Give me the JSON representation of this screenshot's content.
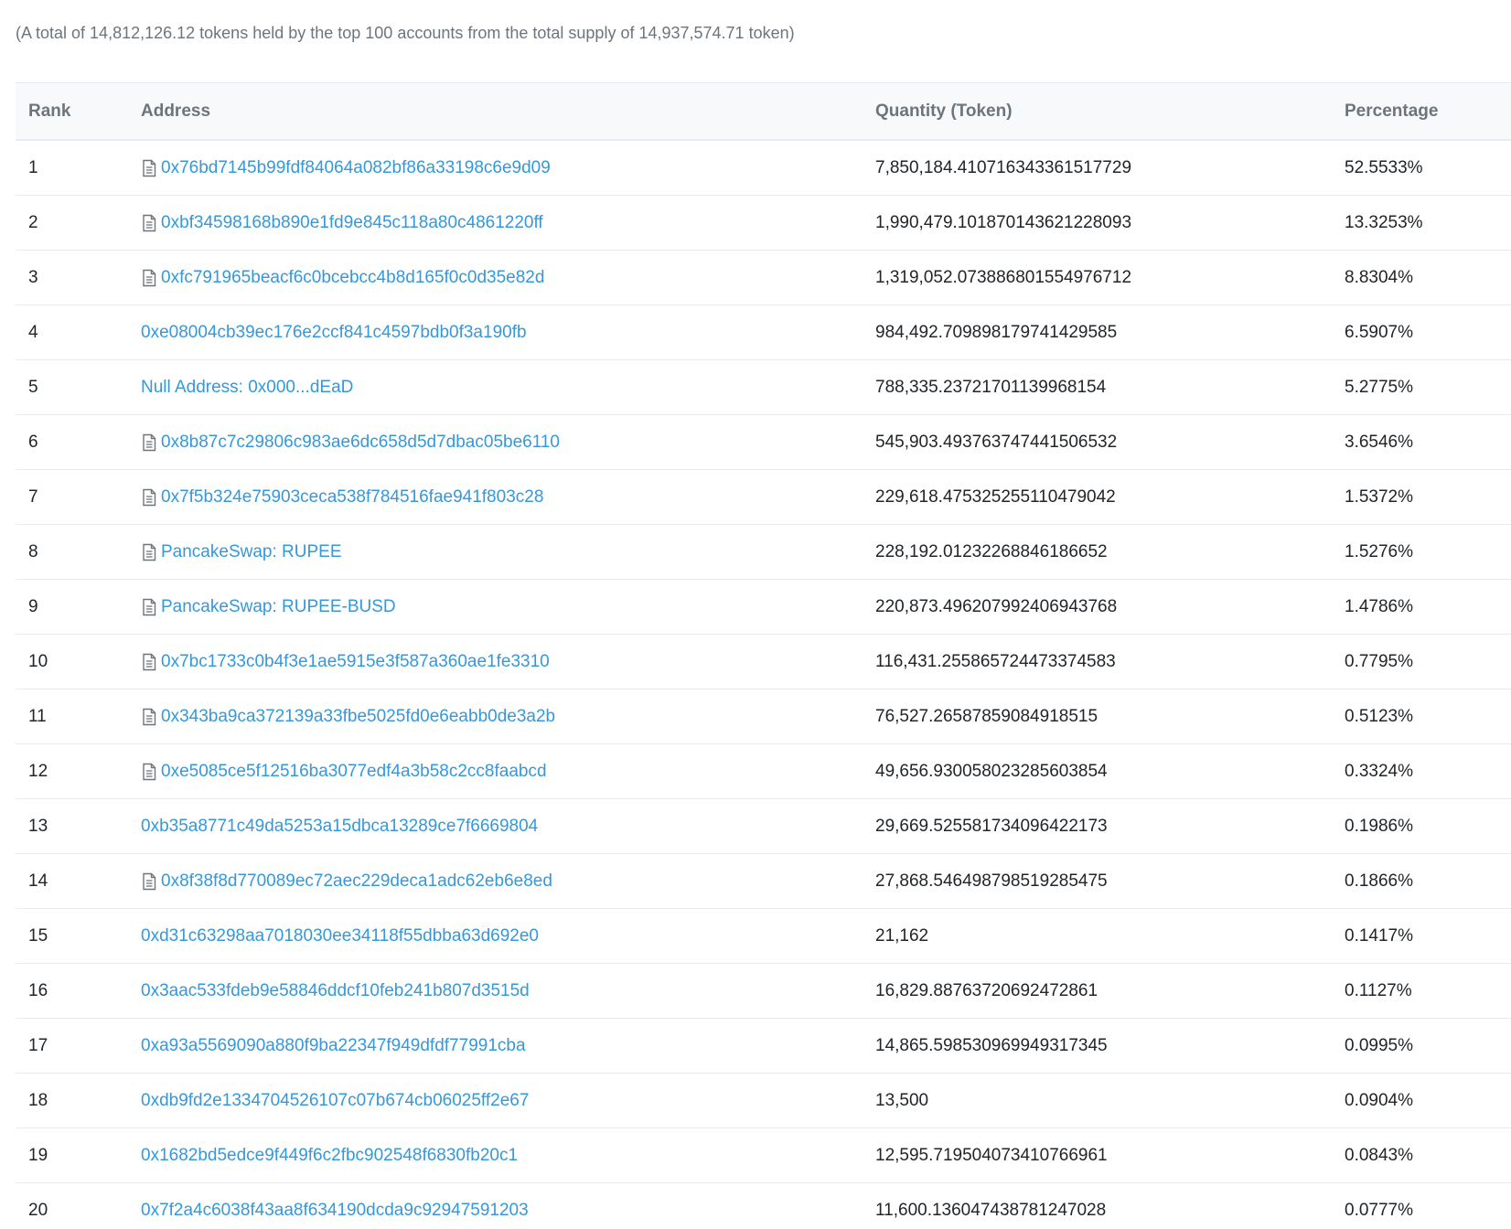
{
  "summary": "(A total of 14,812,126.12 tokens held by the top 100 accounts from the total supply of 14,937,574.71 token)",
  "table": {
    "headers": {
      "rank": "Rank",
      "address": "Address",
      "quantity": "Quantity (Token)",
      "percentage": "Percentage"
    },
    "rows": [
      {
        "rank": "1",
        "address": "0x76bd7145b99fdf84064a082bf86a33198c6e9d09",
        "contract": true,
        "quantity": "7,850,184.410716343361517729",
        "percentage": "52.5533%"
      },
      {
        "rank": "2",
        "address": "0xbf34598168b890e1fd9e845c118a80c4861220ff",
        "contract": true,
        "quantity": "1,990,479.101870143621228093",
        "percentage": "13.3253%"
      },
      {
        "rank": "3",
        "address": "0xfc791965beacf6c0bcebcc4b8d165f0c0d35e82d",
        "contract": true,
        "quantity": "1,319,052.073886801554976712",
        "percentage": "8.8304%"
      },
      {
        "rank": "4",
        "address": "0xe08004cb39ec176e2ccf841c4597bdb0f3a190fb",
        "contract": false,
        "quantity": "984,492.709898179741429585",
        "percentage": "6.5907%"
      },
      {
        "rank": "5",
        "address": "Null Address: 0x000...dEaD",
        "contract": false,
        "quantity": "788,335.23721701139968154",
        "percentage": "5.2775%"
      },
      {
        "rank": "6",
        "address": "0x8b87c7c29806c983ae6dc658d5d7dbac05be6110",
        "contract": true,
        "quantity": "545,903.493763747441506532",
        "percentage": "3.6546%"
      },
      {
        "rank": "7",
        "address": "0x7f5b324e75903ceca538f784516fae941f803c28",
        "contract": true,
        "quantity": "229,618.475325255110479042",
        "percentage": "1.5372%"
      },
      {
        "rank": "8",
        "address": "PancakeSwap: RUPEE",
        "contract": true,
        "quantity": "228,192.01232268846186652",
        "percentage": "1.5276%"
      },
      {
        "rank": "9",
        "address": "PancakeSwap: RUPEE-BUSD",
        "contract": true,
        "quantity": "220,873.496207992406943768",
        "percentage": "1.4786%"
      },
      {
        "rank": "10",
        "address": "0x7bc1733c0b4f3e1ae5915e3f587a360ae1fe3310",
        "contract": true,
        "quantity": "116,431.255865724473374583",
        "percentage": "0.7795%"
      },
      {
        "rank": "11",
        "address": "0x343ba9ca372139a33fbe5025fd0e6eabb0de3a2b",
        "contract": true,
        "quantity": "76,527.26587859084918515",
        "percentage": "0.5123%"
      },
      {
        "rank": "12",
        "address": "0xe5085ce5f12516ba3077edf4a3b58c2cc8faabcd",
        "contract": true,
        "quantity": "49,656.930058023285603854",
        "percentage": "0.3324%"
      },
      {
        "rank": "13",
        "address": "0xb35a8771c49da5253a15dbca13289ce7f6669804",
        "contract": false,
        "quantity": "29,669.525581734096422173",
        "percentage": "0.1986%"
      },
      {
        "rank": "14",
        "address": "0x8f38f8d770089ec72aec229deca1adc62eb6e8ed",
        "contract": true,
        "quantity": "27,868.546498798519285475",
        "percentage": "0.1866%"
      },
      {
        "rank": "15",
        "address": "0xd31c63298aa7018030ee34118f55dbba63d692e0",
        "contract": false,
        "quantity": "21,162",
        "percentage": "0.1417%"
      },
      {
        "rank": "16",
        "address": "0x3aac533fdeb9e58846ddcf10feb241b807d3515d",
        "contract": false,
        "quantity": "16,829.88763720692472861",
        "percentage": "0.1127%"
      },
      {
        "rank": "17",
        "address": "0xa93a5569090a880f9ba22347f949dfdf77991cba",
        "contract": false,
        "quantity": "14,865.598530969949317345",
        "percentage": "0.0995%"
      },
      {
        "rank": "18",
        "address": "0xdb9fd2e1334704526107c07b674cb06025ff2e67",
        "contract": false,
        "quantity": "13,500",
        "percentage": "0.0904%"
      },
      {
        "rank": "19",
        "address": "0x1682bd5edce9f449f6c2fbc902548f6830fb20c1",
        "contract": false,
        "quantity": "12,595.719504073410766961",
        "percentage": "0.0843%"
      },
      {
        "rank": "20",
        "address": "0x7f2a4c6038f43aa8f634190dcda9c92947591203",
        "contract": false,
        "quantity": "11,600.136047438781247028",
        "percentage": "0.0777%"
      }
    ]
  },
  "colors": {
    "link": "#3498db",
    "muted_text": "#6c757d",
    "body_text": "#212529",
    "border": "#e7eaf3",
    "header_bg": "#f8f9fa"
  },
  "icons": {
    "contract": "document-icon"
  }
}
